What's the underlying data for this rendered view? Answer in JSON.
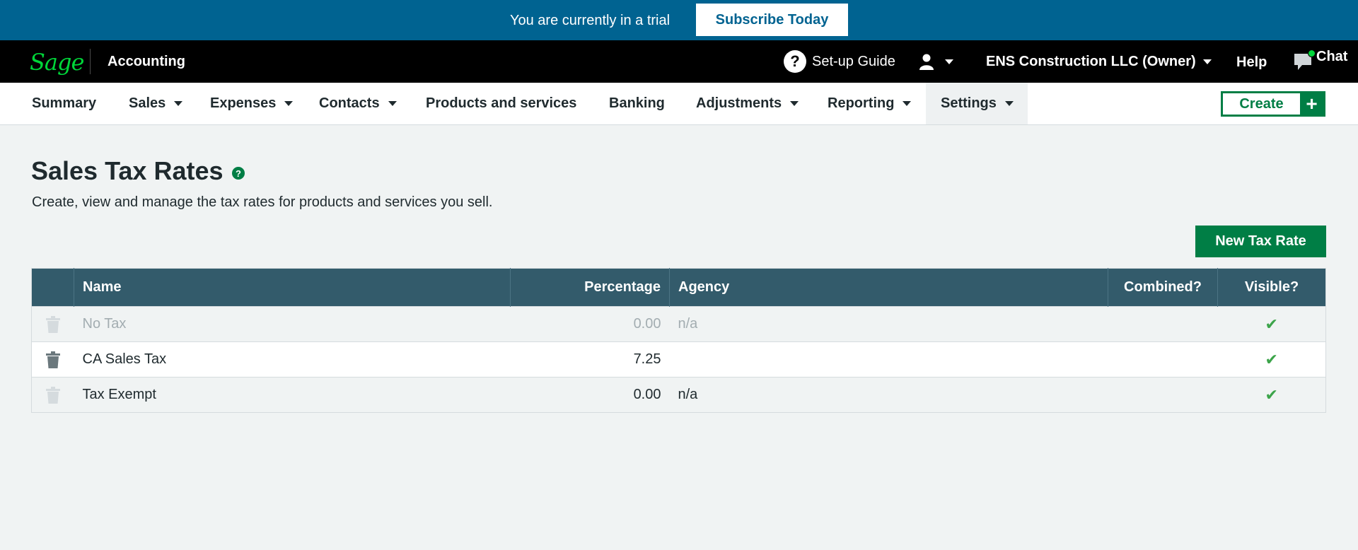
{
  "trial_bar": {
    "message": "You are currently in a trial",
    "subscribe_label": "Subscribe Today"
  },
  "header": {
    "logo": "Sage",
    "app_name": "Accounting",
    "setup_guide_label": "Set-up Guide",
    "company_label": "ENS Construction LLC (Owner)",
    "help_label": "Help",
    "chat_label": "Chat"
  },
  "nav": {
    "items": [
      {
        "label": "Summary",
        "dropdown": false
      },
      {
        "label": "Sales",
        "dropdown": true
      },
      {
        "label": "Expenses",
        "dropdown": true
      },
      {
        "label": "Contacts",
        "dropdown": true
      },
      {
        "label": "Products and services",
        "dropdown": false
      },
      {
        "label": "Banking",
        "dropdown": false
      },
      {
        "label": "Adjustments",
        "dropdown": true
      },
      {
        "label": "Reporting",
        "dropdown": true
      },
      {
        "label": "Settings",
        "dropdown": true,
        "active": true
      }
    ],
    "create_label": "Create",
    "create_plus": "+"
  },
  "page": {
    "title": "Sales Tax Rates",
    "help_icon": "?",
    "description": "Create, view and manage the tax rates for products and services you sell.",
    "new_button_label": "New Tax Rate"
  },
  "table": {
    "columns": [
      "",
      "Name",
      "Percentage",
      "Agency",
      "Combined?",
      "Visible?"
    ],
    "rows": [
      {
        "name": "No Tax",
        "percentage": "0.00",
        "agency": "n/a",
        "combined": "",
        "visible": "✔",
        "style": "muted"
      },
      {
        "name": "CA Sales Tax",
        "percentage": "7.25",
        "agency": "",
        "combined": "",
        "visible": "✔",
        "style": "white"
      },
      {
        "name": "Tax Exempt",
        "percentage": "0.00",
        "agency": "n/a",
        "combined": "",
        "visible": "✔",
        "style": "normal"
      }
    ]
  },
  "colors": {
    "trial_bar": "#006391",
    "header": "#000000",
    "brand_green": "#00d639",
    "primary_green": "#007e45",
    "table_header": "#335b6b",
    "check_green": "#3ca44a"
  }
}
